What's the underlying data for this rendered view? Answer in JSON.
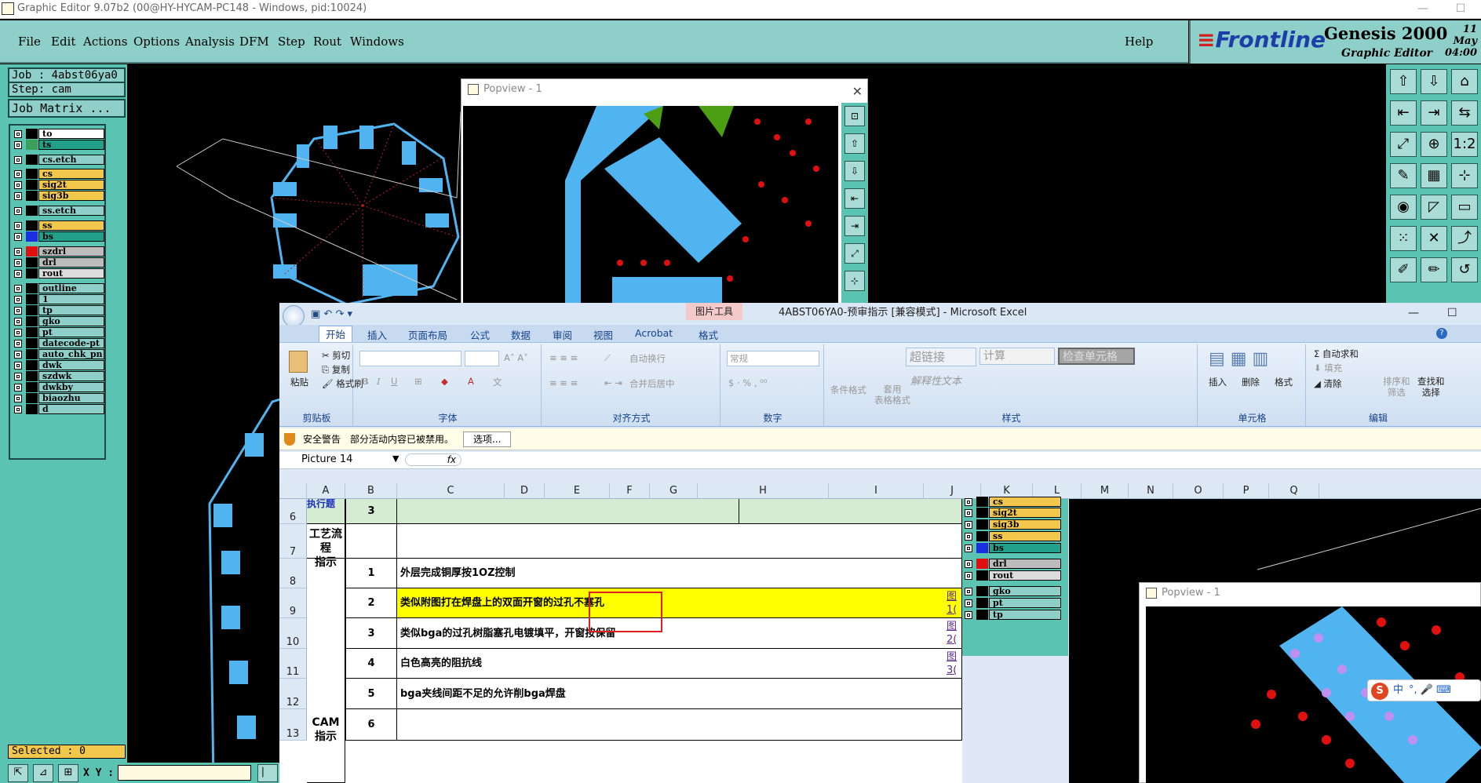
{
  "window": {
    "title": "Graphic Editor 9.07b2 (00@HY-HYCAM-PC148 - Windows, pid:10024)"
  },
  "menu": {
    "items": [
      "File",
      "Edit",
      "Actions",
      "Options",
      "Analysis",
      "DFM",
      "Step",
      "Rout",
      "Windows"
    ],
    "help": "Help"
  },
  "brand": {
    "logo": "Frontline",
    "product": "Genesis 2000",
    "subtitle": "Graphic Editor",
    "date": "11 May",
    "time": "04:00"
  },
  "left": {
    "job": "Job : 4abst06ya0",
    "step": "Step: cam",
    "matrix_button": "Job Matrix ...",
    "selected": "Selected : 0",
    "xy_label": "X Y :"
  },
  "layers": [
    {
      "name": "to",
      "color": "#ffffff",
      "swatch": "#000000"
    },
    {
      "name": "ts",
      "color": "#22a08a",
      "swatch": "#3aa05a"
    },
    {
      "name": "cs.etch",
      "color": "#8ecfca",
      "swatch": "#000000"
    },
    {
      "name": "cs",
      "color": "#f2c84c",
      "swatch": "#000000"
    },
    {
      "name": "sig2t",
      "color": "#f2c84c",
      "swatch": "#000000"
    },
    {
      "name": "sig3b",
      "color": "#f2c84c",
      "swatch": "#000000"
    },
    {
      "name": "ss.etch",
      "color": "#8ecfca",
      "swatch": "#000000"
    },
    {
      "name": "ss",
      "color": "#f2c84c",
      "swatch": "#000000"
    },
    {
      "name": "bs",
      "color": "#22a08a",
      "swatch": "#1a30e0"
    },
    {
      "name": "szdrl",
      "color": "#bcbcbc",
      "swatch": "#e01010"
    },
    {
      "name": "drl",
      "color": "#bcbcbc",
      "swatch": "#000000"
    },
    {
      "name": "rout",
      "color": "#dcdcdc",
      "swatch": "#000000"
    },
    {
      "name": "outline",
      "color": "#8ecfca",
      "swatch": "#000000"
    },
    {
      "name": "1",
      "color": "#8ecfca",
      "swatch": "#000000"
    },
    {
      "name": "tp",
      "color": "#8ecfca",
      "swatch": "#000000"
    },
    {
      "name": "gko",
      "color": "#8ecfca",
      "swatch": "#000000"
    },
    {
      "name": "pt",
      "color": "#8ecfca",
      "swatch": "#000000"
    },
    {
      "name": "datecode-pt",
      "color": "#8ecfca",
      "swatch": "#000000"
    },
    {
      "name": "auto_chk_pn",
      "color": "#8ecfca",
      "swatch": "#000000"
    },
    {
      "name": "dwk",
      "color": "#8ecfca",
      "swatch": "#000000"
    },
    {
      "name": "szdwk",
      "color": "#8ecfca",
      "swatch": "#000000"
    },
    {
      "name": "dwkby",
      "color": "#8ecfca",
      "swatch": "#000000"
    },
    {
      "name": "biaozhu",
      "color": "#8ecfca",
      "swatch": "#000000"
    },
    {
      "name": "d",
      "color": "#8ecfca",
      "swatch": "#000000"
    }
  ],
  "popview": {
    "title": "Popview - 1"
  },
  "excel": {
    "title": "4ABST06YA0-预审指示 [兼容模式] - Microsoft Excel",
    "context_tab": "图片工具",
    "tabs": [
      "开始",
      "插入",
      "页面布局",
      "公式",
      "数据",
      "审阅",
      "视图",
      "Acrobat",
      "格式"
    ],
    "clipboard": {
      "paste": "粘贴",
      "cut": "剪切",
      "copy": "复制",
      "format_painter": "格式刷",
      "group": "剪贴板"
    },
    "font_group": "字体",
    "align": {
      "wrap": "自动换行",
      "merge": "合并后居中",
      "group": "对齐方式"
    },
    "number": {
      "format": "常规",
      "group": "数字"
    },
    "styles": {
      "conditional": "条件格式",
      "table": "套用\n表格格式",
      "hyperlink": "超链接",
      "calc": "计算",
      "check": "检查单元格",
      "explain": "解释性文本",
      "group": "样式"
    },
    "cells": {
      "insert": "插入",
      "delete": "删除",
      "format": "格式",
      "group": "单元格"
    },
    "editing": {
      "autosum": "自动求和",
      "fill": "填充",
      "clear": "清除",
      "sort": "排序和\n筛选",
      "find": "查找和\n选择",
      "group": "编辑"
    },
    "security": {
      "warning": "安全警告",
      "message": "部分活动内容已被禁用。",
      "options": "选项..."
    },
    "namebox": "Picture 14",
    "fx": "fx",
    "columns": [
      "A",
      "B",
      "C",
      "D",
      "E",
      "F",
      "G",
      "H",
      "I",
      "J",
      "K",
      "L",
      "M",
      "N",
      "O",
      "P",
      "Q"
    ],
    "rows": [
      {
        "num": "6",
        "b": "3",
        "c": ""
      },
      {
        "num": "7",
        "a": "工艺流程\n指示",
        "b": "",
        "c": ""
      },
      {
        "num": "8",
        "b": "1",
        "c": "外层完成铜厚按1OZ控制"
      },
      {
        "num": "9",
        "b": "2",
        "c": "类似附图打在焊盘上的双面开窗的过孔不塞孔"
      },
      {
        "num": "10",
        "b": "3",
        "c": "类似bga的过孔树脂塞孔电镀填平，开窗按保留"
      },
      {
        "num": "11",
        "b": "4",
        "c": "白色高亮的阻抗线"
      },
      {
        "num": "12",
        "a": "CAM\n指示",
        "b": "5",
        "c": "bga夹线间距不足的允许削bga焊盘"
      },
      {
        "num": "13",
        "b": "6",
        "c": ""
      }
    ],
    "links": [
      "图\n1(",
      "图\n2(",
      "图\n3("
    ],
    "row6_a_partial": "执行题"
  },
  "overlay_layers": [
    "cs",
    "sig2t",
    "sig3b",
    "ss",
    "bs",
    "drl",
    "rout",
    "gko",
    "pt",
    "tp"
  ],
  "popview2": {
    "title": "Popview - 1"
  },
  "ime": {
    "label": "中"
  }
}
